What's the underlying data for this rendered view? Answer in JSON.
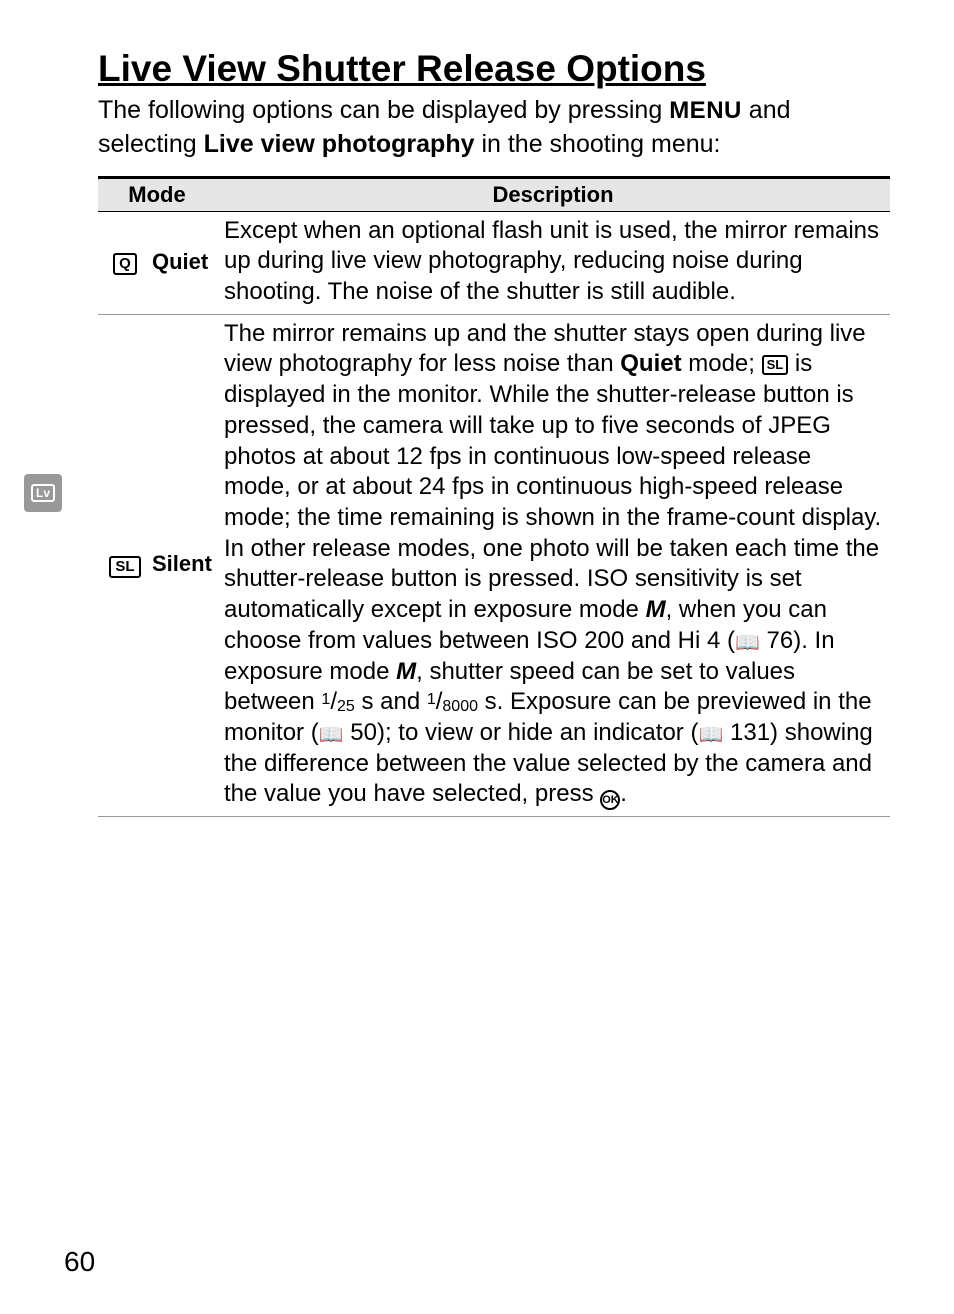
{
  "page_number": "60",
  "side_tab_label": "Lv",
  "title": "Live View Shutter Release Options",
  "intro_parts": {
    "p1": "The following options can be displayed by pressing ",
    "menu": "MENU",
    "p2": " and selecting ",
    "bold": "Live view photography",
    "p3": " in the shooting menu:"
  },
  "table": {
    "headers": {
      "mode": "Mode",
      "description": "Description"
    },
    "rows": [
      {
        "icon_text": "Q",
        "label": "Quiet",
        "desc_plain": "Except when an optional flash unit is used, the mirror remains up during live view photography, reducing noise during shooting.  The noise of the shutter is still audible."
      },
      {
        "icon_text": "SL",
        "label": "Silent"
      }
    ]
  },
  "silent": {
    "s1": "The mirror remains up and the shutter stays open during live view photography for less noise than ",
    "quiet_bold": "Quiet",
    "s2": " mode; ",
    "sl_icon": "SL",
    "s3": " is displayed in the monitor.  While the shutter-release button is pressed, the camera will take up to five seconds of JPEG photos at about 12 fps in continuous low-speed release mode, or at about 24 fps in continuous high-speed release mode; the time remaining is shown in the frame-count display.  In other release modes, one photo will be taken each time the shutter-release button is pressed.  ISO sensitivity is set automatically except in exposure mode ",
    "mode_m1": "M",
    "s4": ", when you can choose from values between ISO 200 and Hi 4 (",
    "book1": "📖",
    "ref1": " 76).  In exposure mode ",
    "mode_m2": "M",
    "s5": ", shutter speed can be set to values between ",
    "frac1_num": "1",
    "frac1_slash": "/",
    "frac1_den": "25",
    "s6": " s and ",
    "frac2_num": "1",
    "frac2_slash": "/",
    "frac2_den": "8000",
    "s7": " s.  Exposure can be previewed in the monitor (",
    "book2": "📖",
    "ref2": " 50); to view or hide an indicator (",
    "book3": "📖",
    "ref3": " 131) showing the difference between the value selected by the camera and the value you have selected, press ",
    "ok": "OK",
    "s8": "."
  },
  "chart_data": {
    "type": "table",
    "title": "Live View Shutter Release Options",
    "columns": [
      "Mode",
      "Description"
    ],
    "rows": [
      [
        "Q — Quiet",
        "Except when an optional flash unit is used, the mirror remains up during live view photography, reducing noise during shooting. The noise of the shutter is still audible."
      ],
      [
        "SL — Silent",
        "The mirror remains up and the shutter stays open during live view photography for less noise than Quiet mode; SL is displayed in the monitor. While the shutter-release button is pressed, the camera will take up to five seconds of JPEG photos at about 12 fps in continuous low-speed release mode, or at about 24 fps in continuous high-speed release mode; the time remaining is shown in the frame-count display. In other release modes, one photo will be taken each time the shutter-release button is pressed. ISO sensitivity is set automatically except in exposure mode M, when you can choose from values between ISO 200 and Hi 4 (p. 76). In exposure mode M, shutter speed can be set to values between 1/25 s and 1/8000 s. Exposure can be previewed in the monitor (p. 50); to view or hide an indicator (p. 131) showing the difference between the value selected by the camera and the value you have selected, press OK."
      ]
    ]
  }
}
